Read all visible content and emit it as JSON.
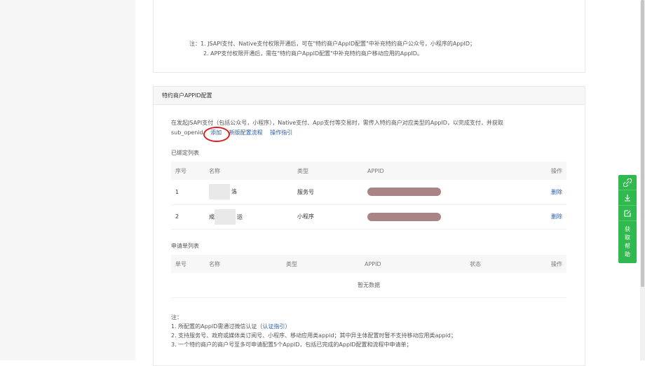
{
  "top_note": {
    "line1": "注：1. JSAPI支付、Native支付权限开通后，可在\"特约商户AppID配置\"中补充特约商户公众号，小程序的AppID；",
    "line2": "2. APP支付权限开通后，需在\"特约商户AppID配置\"中补充特约商户移动应用的AppID。"
  },
  "panel": {
    "title": "特约商户APPID配置",
    "desc": "在发起JSAPI支付（包括公众号，小程序），Native支付、App支付等交易时，需传入特约商户对应类型的AppID，以完成支付，并获取",
    "desc2": "sub_openid",
    "add_link": "添加",
    "new_flow_link": "新版配置流程",
    "guide_link": "操作指引"
  },
  "bound_list": {
    "title": "已绑定列表",
    "headers": [
      "序号",
      "名称",
      "类型",
      "APPID",
      "操作"
    ],
    "rows": [
      {
        "index": "1",
        "name_suffix": "洛",
        "type": "服务号",
        "action": "删除"
      },
      {
        "index": "2",
        "name_prefix": "成",
        "name_suffix": "运",
        "type": "小程序",
        "action": "删除"
      }
    ]
  },
  "apply_list": {
    "title": "申请单列表",
    "headers": [
      "单号",
      "名称",
      "类型",
      "APPID",
      "状态",
      "操作"
    ],
    "empty": "暂无数据"
  },
  "bottom_notes": {
    "head": "注：",
    "n1": "1. 所配置的AppID需通过微信认证（",
    "n1_link": "认证指引",
    "n1_end": "）",
    "n2": "2. 支持服务号、政府或媒体类订阅号、小程序、移动应用类appid；其中异主体配置时暂不支持移动应用类appid；",
    "n3": "3. 一个特约商户的商户号至多可申请配置5个AppID，包括已完成的AppID配置和流程中申请单；"
  },
  "float_bar": {
    "icons": [
      "link-icon",
      "download-icon",
      "edit-icon"
    ],
    "help": [
      "获",
      "取",
      "帮",
      "助"
    ]
  },
  "colors": {
    "accent": "#2fb94f",
    "link": "#2b5ca8",
    "circle": "#d81e1e"
  }
}
